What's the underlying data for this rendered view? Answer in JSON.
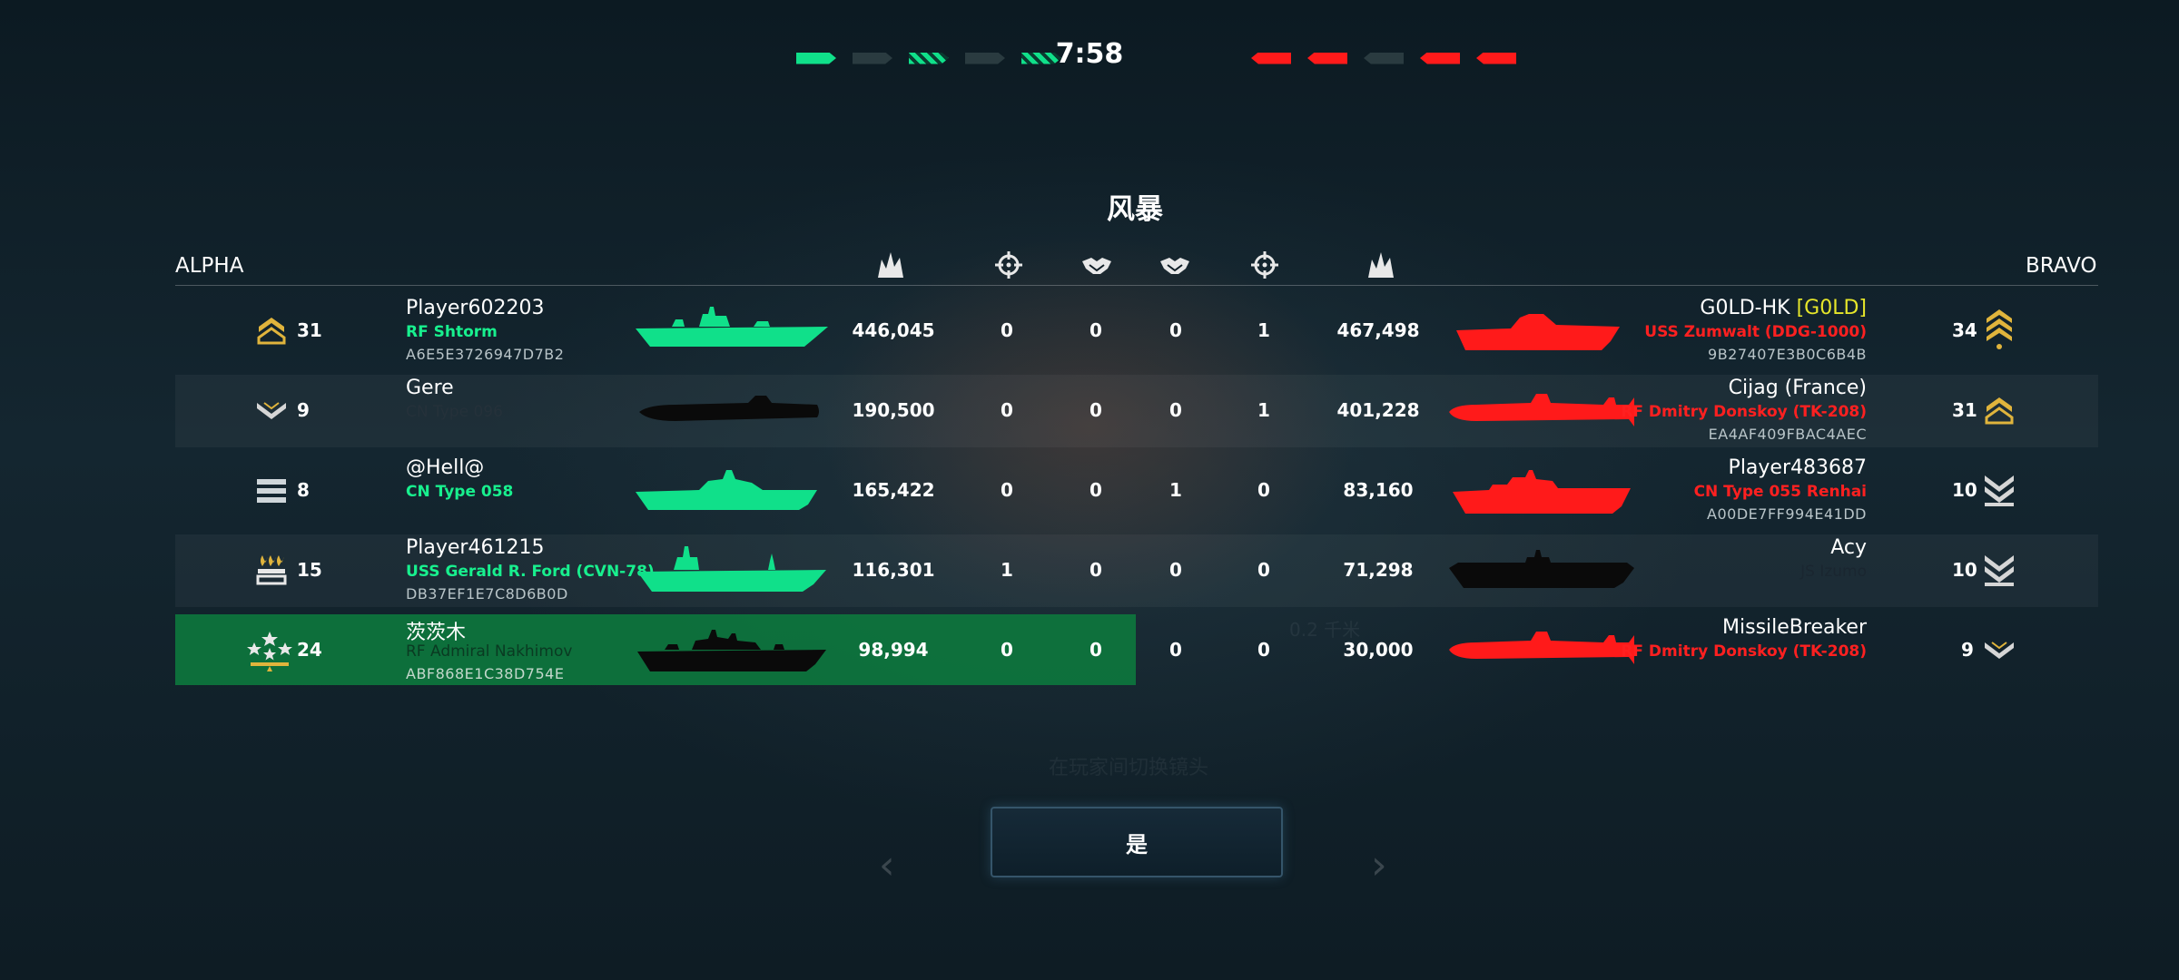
{
  "match": {
    "timer": "7:58",
    "map_name": "风暴"
  },
  "progress": {
    "alpha": [
      "on",
      "dim",
      "striped",
      "dim",
      "striped"
    ],
    "bravo": [
      "on",
      "on",
      "dim",
      "on",
      "on"
    ]
  },
  "teams": {
    "left": "ALPHA",
    "right": "BRAVO"
  },
  "header_icons": [
    "damage-icon",
    "kill-icon",
    "assist-icon",
    "assist-icon",
    "kill-icon",
    "damage-icon"
  ],
  "colors": {
    "alpha": "#18f08e",
    "bravo": "#ff2020",
    "highlight": "#0d7a3d",
    "tag": "#e6e62a"
  },
  "rows": [
    {
      "left": {
        "level": "31",
        "name": "Player602203",
        "ship": "RF Shtorm",
        "id": "A6E5E3726947D7B2",
        "ship_color": "green",
        "rank_icon": "gold-chevron-rank-icon"
      },
      "stats": {
        "l_damage": "446,045",
        "l_kills": "0",
        "l_assists": "0",
        "r_assists": "0",
        "r_kills": "1",
        "r_damage": "467,498"
      },
      "right": {
        "level": "34",
        "name": "G0LD-HK",
        "tag": "[G0LD]",
        "ship": "USS Zumwalt (DDG-1000)",
        "id": "9B27407E3B0C6B4B",
        "ship_color": "red",
        "rank_icon": "gold-triple-chevron-rank-icon"
      }
    },
    {
      "left": {
        "level": "9",
        "name": "Gere",
        "ship": "CN Type 096",
        "id": "",
        "ship_color": "dark",
        "rank_icon": "silver-chevron-rank-icon"
      },
      "stats": {
        "l_damage": "190,500",
        "l_kills": "0",
        "l_assists": "0",
        "r_assists": "0",
        "r_kills": "1",
        "r_damage": "401,228"
      },
      "right": {
        "level": "31",
        "name": "Cijag (France)",
        "tag": "",
        "ship": "RF Dmitry Donskoy (TK-208)",
        "id": "EA4AF409FBAC4AEC",
        "ship_color": "red",
        "rank_icon": "gold-chevron-rank-icon"
      }
    },
    {
      "left": {
        "level": "8",
        "name": "@Hell@",
        "ship": "CN Type 058",
        "id": "",
        "ship_color": "green",
        "rank_icon": "bars-rank-icon"
      },
      "stats": {
        "l_damage": "165,422",
        "l_kills": "0",
        "l_assists": "0",
        "r_assists": "1",
        "r_kills": "0",
        "r_damage": "83,160"
      },
      "right": {
        "level": "10",
        "name": "Player483687",
        "tag": "",
        "ship": "CN Type 055 Renhai",
        "id": "A00DE7FF994E41DD",
        "ship_color": "red",
        "rank_icon": "silver-double-chevron-rank-icon"
      }
    },
    {
      "left": {
        "level": "15",
        "name": "Player461215",
        "ship": "USS Gerald R. Ford (CVN-78)",
        "id": "DB37EF1E7C8D6B0D",
        "ship_color": "green",
        "rank_icon": "flames-rank-icon"
      },
      "stats": {
        "l_damage": "116,301",
        "l_kills": "1",
        "l_assists": "0",
        "r_assists": "0",
        "r_kills": "0",
        "r_damage": "71,298"
      },
      "right": {
        "level": "10",
        "name": "Acy",
        "tag": "",
        "ship": "JS Izumo",
        "id": "",
        "ship_color": "dark",
        "rank_icon": "silver-double-chevron-rank-icon"
      }
    },
    {
      "left": {
        "level": "24",
        "name": "茨茨木",
        "ship": "RF Admiral Nakhimov",
        "id": "ABF868E1C38D754E",
        "ship_color": "dark",
        "rank_icon": "stars-rank-icon"
      },
      "stats": {
        "l_damage": "98,994",
        "l_kills": "0",
        "l_assists": "0",
        "r_assists": "0",
        "r_kills": "0",
        "r_damage": "30,000"
      },
      "right": {
        "level": "9",
        "name": "MissileBreaker",
        "tag": "",
        "ship": "RF Dmitry Donskoy (TK-208)",
        "id": "",
        "ship_color": "red",
        "rank_icon": "silver-chevron-rank-icon"
      }
    }
  ],
  "background_text": {
    "switch_camera": "在玩家间切换镜头",
    "distance": "0.2 千米"
  },
  "confirm_button": "是"
}
